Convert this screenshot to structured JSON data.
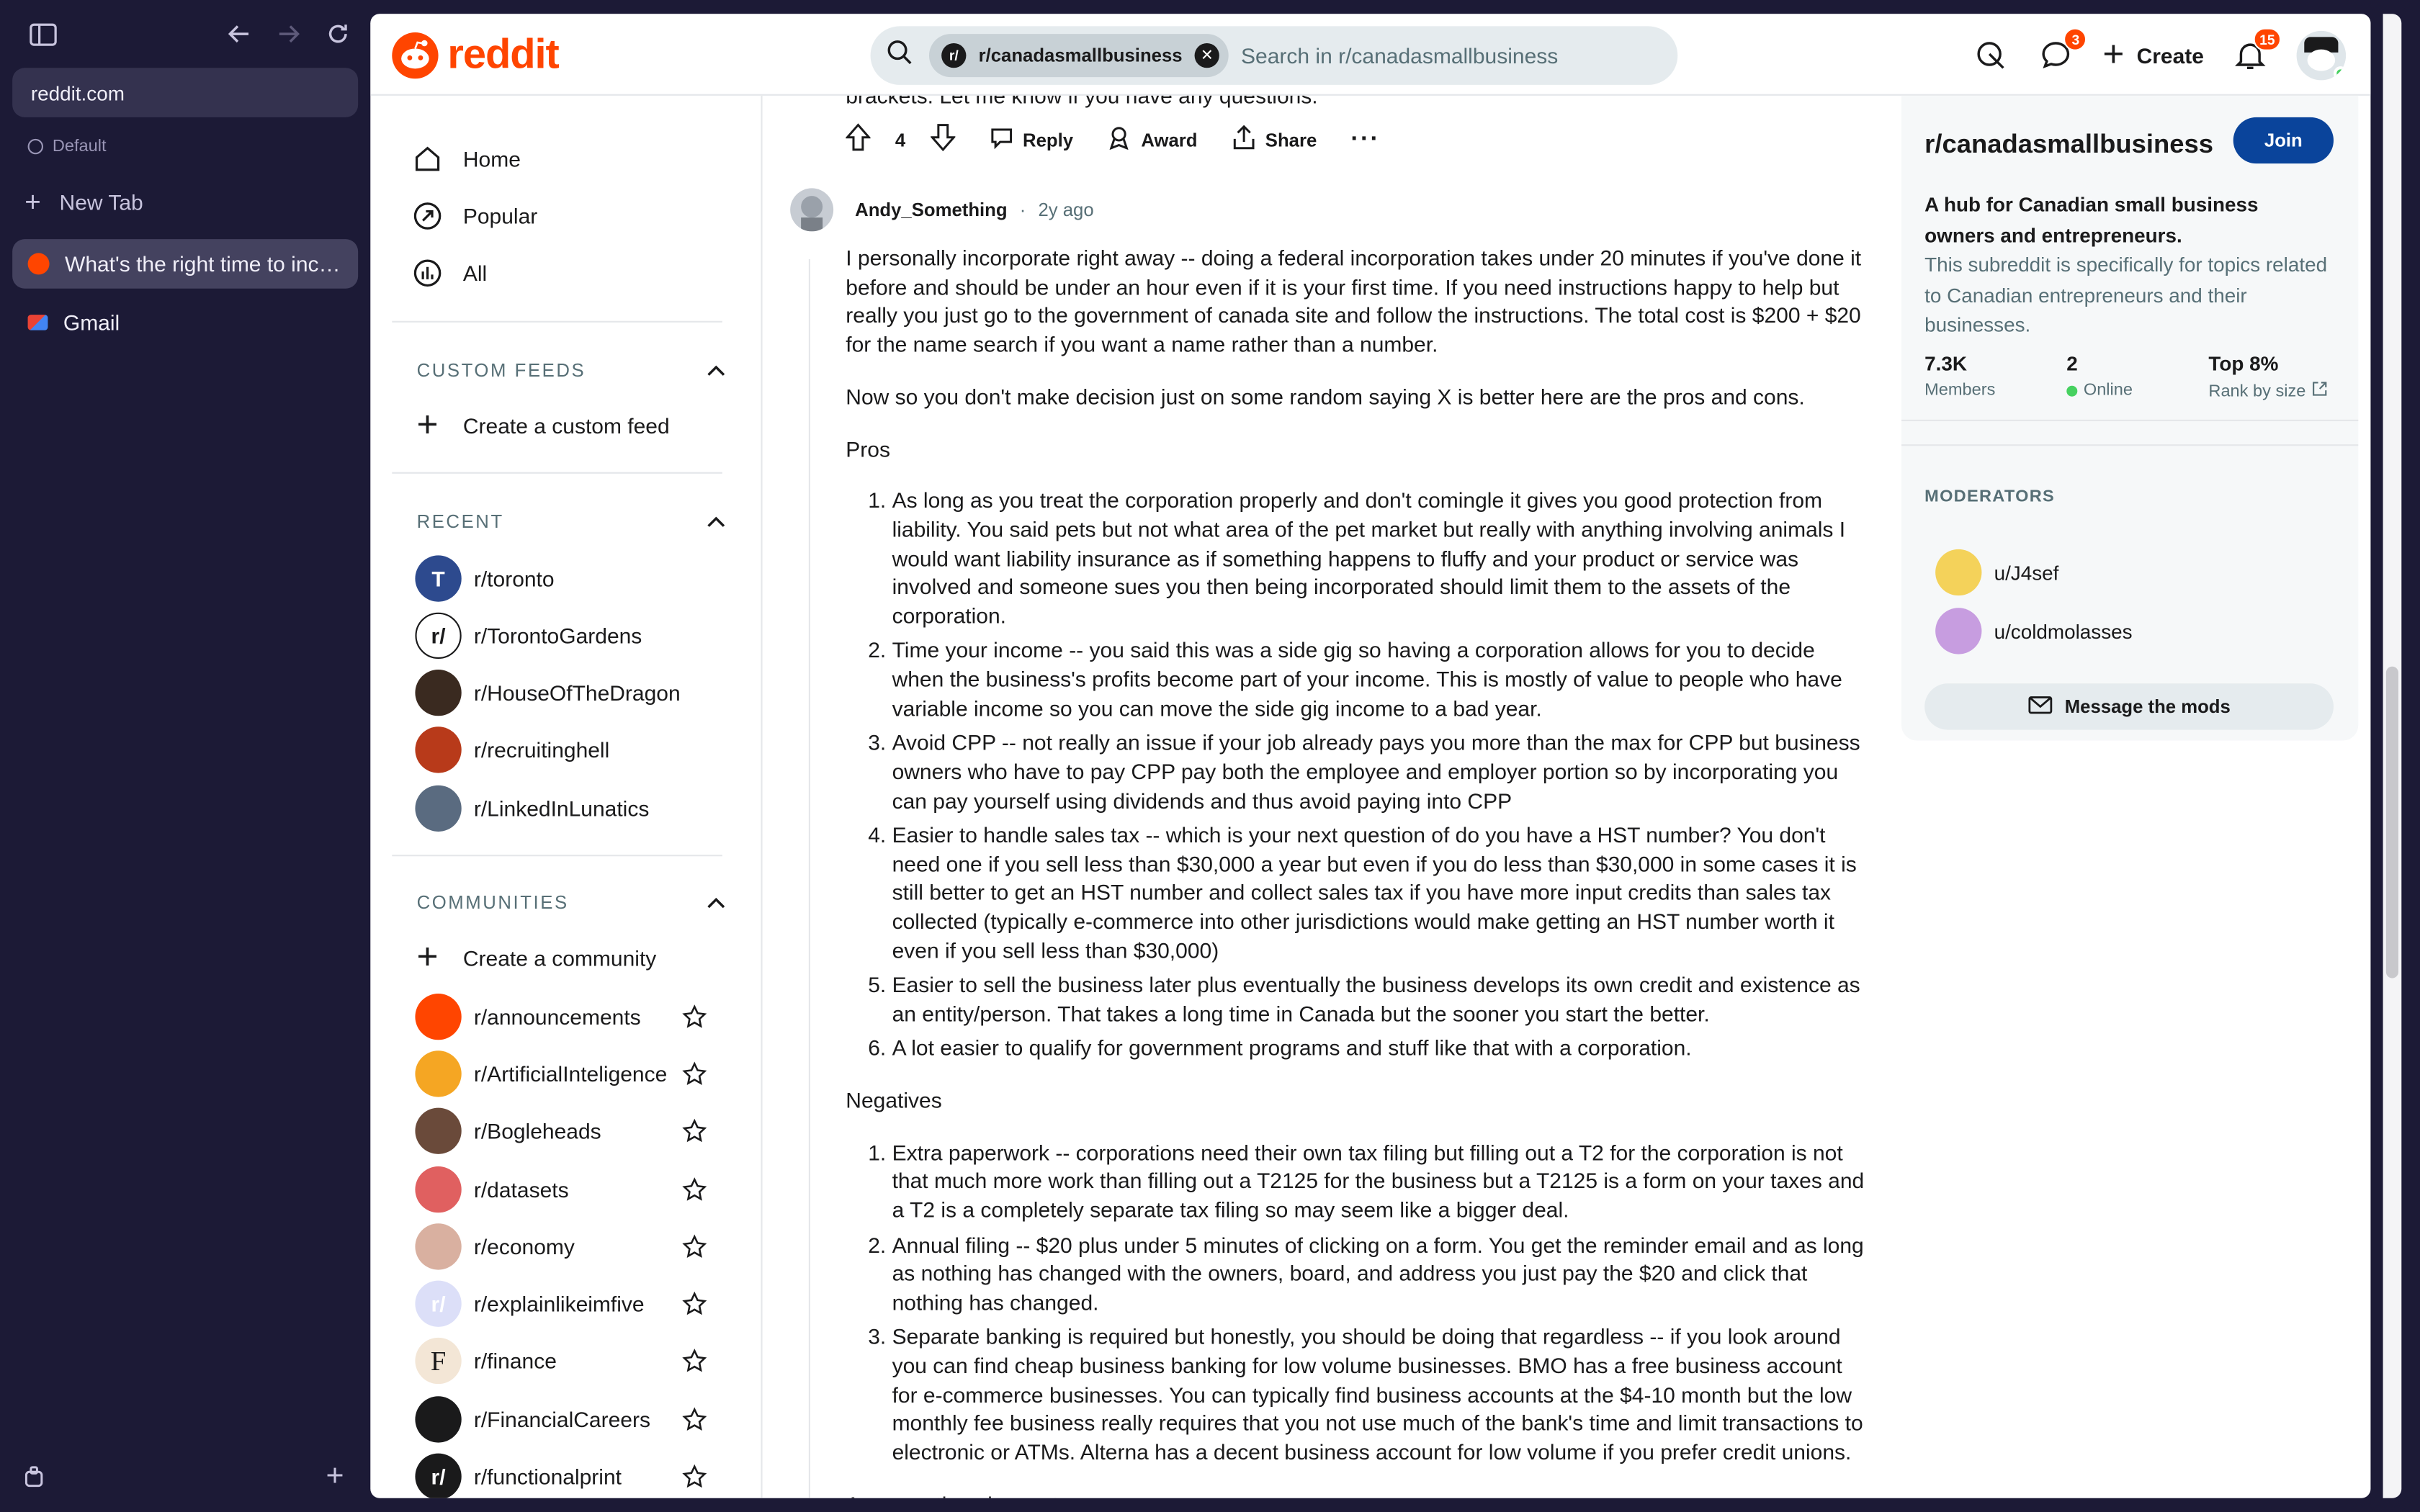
{
  "browser": {
    "url": "reddit.com",
    "profile": "Default",
    "new_tab": "New Tab",
    "tabs": [
      {
        "title": "What's the right time to incorporate?",
        "active": true
      },
      {
        "title": "Gmail",
        "active": false
      }
    ]
  },
  "header": {
    "logo": "reddit",
    "search_chip": "r/canadasmallbusiness",
    "search_placeholder": "Search in r/canadasmallbusiness",
    "chat_badge": "3",
    "create_label": "Create",
    "notif_badge": "15"
  },
  "nav": {
    "items": [
      "Home",
      "Popular",
      "All"
    ],
    "custom_feeds_header": "CUSTOM FEEDS",
    "create_feed": "Create a custom feed",
    "recent_header": "RECENT",
    "recent": [
      "r/toronto",
      "r/TorontoGardens",
      "r/HouseOfTheDragon",
      "r/recruitinghell",
      "r/LinkedInLunatics"
    ],
    "communities_header": "COMMUNITIES",
    "create_community": "Create a community",
    "communities": [
      "r/announcements",
      "r/ArtificialInteligence",
      "r/Bogleheads",
      "r/datasets",
      "r/economy",
      "r/explainlikeimfive",
      "r/finance",
      "r/FinancialCareers",
      "r/functionalprint"
    ]
  },
  "prev_comment": {
    "tail": "brackets. Let me know if you have any questions.",
    "votes": "4",
    "reply": "Reply",
    "award": "Award",
    "share": "Share"
  },
  "comment": {
    "author": "Andy_Something",
    "time": "2y ago",
    "p1": "I personally incorporate right away -- doing a federal incorporation takes under 20 minutes if you've done it before and should be under an hour even if it is your first time. If you need instructions happy to help but really you just go to the government of canada site and follow the instructions. The total cost is $200 + $20 for the name search if you want a name rather than a number.",
    "p2": "Now so you don't make decision just on some random saying X is better here are the pros and cons.",
    "pros_label": "Pros",
    "pros": [
      "As long as you treat the corporation properly and don't comingle it gives you good protection from liability. You said pets but not what area of the pet market but really with anything involving animals I would want liability insurance as if something happens to fluffy and your product or service was involved and someone sues you then being incorporated should limit them to the assets of the corporation.",
      "Time your income -- you said this was a side gig so having a corporation allows for you to decide when the business's profits become part of your income. This is mostly of value to people who have variable income so you can move the side gig income to a bad year.",
      "Avoid CPP -- not really an issue if your job already pays you more than the max for CPP but business owners who have to pay CPP pay both the employee and employer portion so by incorporating you can pay yourself using dividends and thus avoid paying into CPP",
      "Easier to handle sales tax -- which is your next question of do you have a HST number? You don't need one if you sell less than $30,000 a year but even if you do less than $30,000 in some cases it is still better to get an HST number and collect sales tax if you have more input credits than sales tax collected (typically e-commerce into other jurisdictions would make getting an HST number worth it even if you sell less than $30,000)",
      "Easier to sell the business later plus eventually the business develops its own credit and existence as an entity/person. That takes a long time in Canada but the sooner you start the better.",
      "A lot easier to qualify for government programs and stuff like that with a corporation."
    ],
    "neg_label": "Negatives",
    "negatives": [
      "Extra paperwork -- corporations need their own tax filing but filling out a T2 for the corporation is not that much more work than filling out a T2125 for the business but a T2125 is a form on your taxes and a T2 is a completely separate tax filing so may seem like a bigger deal.",
      "Annual filing -- $20 plus under 5 minutes of clicking on a form. You get the reminder email and as long as nothing has changed with the owners, board, and address you just pay the $20 and click that nothing has changed.",
      "Separate banking is required but honestly, you should be doing that regardless -- if you look around you can find cheap business banking for low volume businesses. BMO has a free business account for e-commerce businesses. You can typically find business accounts at the $4-10 month but the low monthly fee business really requires that you not use much of the bank's time and limit transactions to electronic or ATMs. Alterna has a decent business account for low volume if you prefer credit unions."
    ],
    "closing": "Any questions happy to answer."
  },
  "sidebar": {
    "name": "r/canadasmallbusiness",
    "join": "Join",
    "title": "A hub for Canadian small business owners and entrepreneurs.",
    "description": "This subreddit is specifically for topics related to Canadian entrepreneurs and their businesses.",
    "members_value": "7.3K",
    "members_label": "Members",
    "online_value": "2",
    "online_label": "Online",
    "rank_value": "Top 8%",
    "rank_label": "Rank by size",
    "moderators_header": "MODERATORS",
    "moderators": [
      "u/J4sef",
      "u/coldmolasses"
    ],
    "message_mods": "Message the mods"
  },
  "colors": {
    "accent": "#ff4500",
    "join": "#0a449b",
    "online": "#46d160"
  }
}
